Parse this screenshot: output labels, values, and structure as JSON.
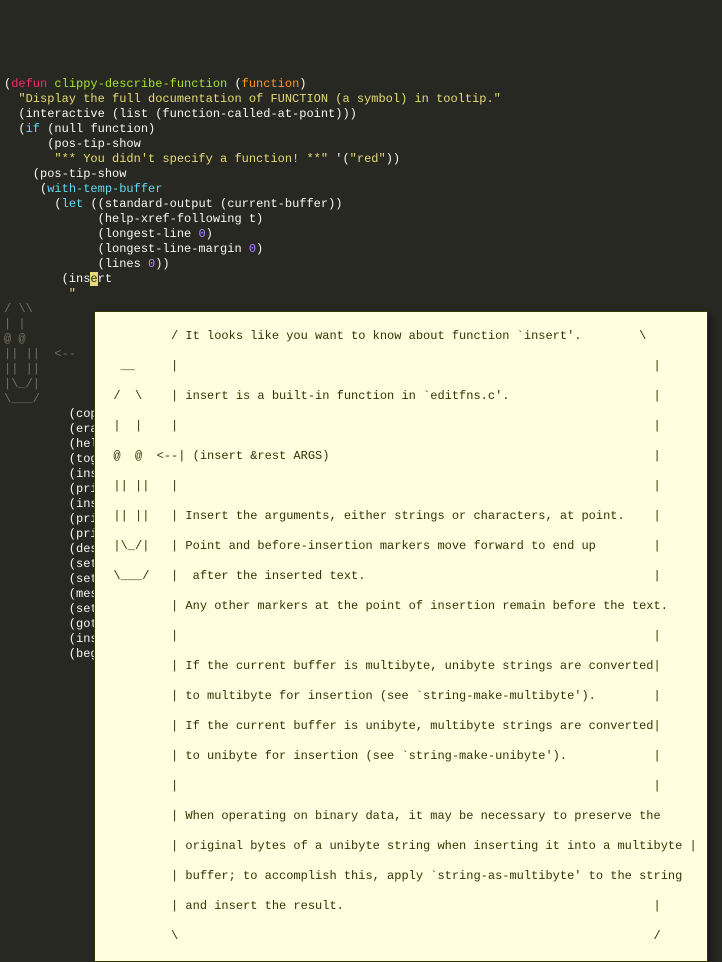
{
  "code": {
    "l1_defun": "defun",
    "l1_fname": "clippy-describe-function",
    "l1_param": "function",
    "l2_doc": "  \"Display the full documentation of FUNCTION (a symbol) in tooltip.\"",
    "l3_interactive": "  (interactive (list (function-called-at-point)))",
    "l4_if": "if",
    "l4_null": "null",
    "l4_func": "function",
    "l5": "      (pos-tip-show",
    "l6_str": "       \"** You didn't specify a function! **\"",
    "l6_q": " '(",
    "l6_red": "\"red\"",
    "l6_end": "))",
    "l7": "    (pos-tip-show",
    "l8_with": "with-temp-buffer",
    "l9_let": "let",
    "l9a": "((standard-output (current-buffer))",
    "l10": "             (help-xref-following t)",
    "l11": "             (longest-line ",
    "l11n": "0",
    "l11e": ")",
    "l12": "             (longest-line-margin ",
    "l12n": "0",
    "l12e": ")",
    "l13": "             (lines ",
    "l13n": "0",
    "l13e": "))",
    "l14a": "        (ins",
    "l14b": "e",
    "l14c": "rt",
    "l15": "         \"",
    "margin1": "/ \\\\",
    "margin2": "| |",
    "margin3": "@ @",
    "margin4": "|| ||  <--",
    "margin5": "|| ||",
    "margin6": "|\\_/|",
    "margin7": "\\___/",
    "partial_cop": "         (cop",
    "partial_era": "         (era",
    "partial_hel": "         (hel",
    "partial_tog": "         (tog",
    "partial_ins": "         (ins",
    "partial_pri": "         (pri",
    "partial_des": "         (des",
    "partial_set": "         (set",
    "partial_mes": "         (mes",
    "bottom1": "         (goto-char (point-max))",
    "bottom2": "         (insert (make-string longest-line ? ))",
    "bottom3": "         (beginning-of-line)"
  },
  "tooltip": {
    "body": [
      "          / It looks like you want to know about function `insert'.        \\",
      "   __     |                                                                  |",
      "  /  \\    | insert is a built-in function in `editfns.c'.                    |",
      "  |  |    |                                                                  |",
      "  @  @  <--| (insert &rest ARGS)                                             |",
      "  || ||   |                                                                  |",
      "  || ||   | Insert the arguments, either strings or characters, at point.    |",
      "  |\\_/|   | Point and before-insertion markers move forward to end up        |",
      "  \\___/   |  after the inserted text.                                        |",
      "          | Any other markers at the point of insertion remain before the text.",
      "          |                                                                  |",
      "          | If the current buffer is multibyte, unibyte strings are converted|",
      "          | to multibyte for insertion (see `string-make-multibyte').        |",
      "          | If the current buffer is unibyte, multibyte strings are converted|",
      "          | to unibyte for insertion (see `string-make-unibyte').            |",
      "          |                                                                  |",
      "          | When operating on binary data, it may be necessary to preserve the",
      "          | original bytes of a unibyte string when inserting it into a multibyte |",
      "          | buffer; to accomplish this, apply `string-as-multibyte' to the string",
      "          | and insert the result.                                           |",
      "          \\                                                                  /"
    ]
  }
}
